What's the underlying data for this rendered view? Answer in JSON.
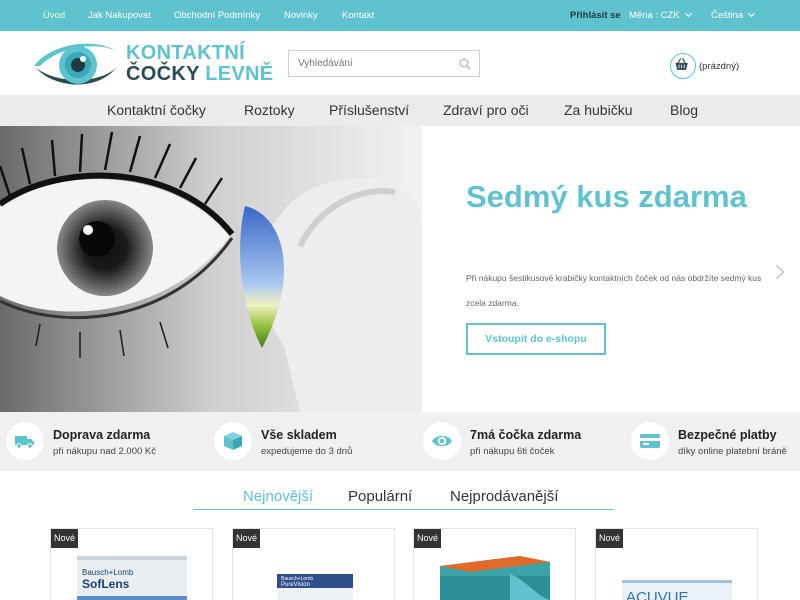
{
  "topbar": {
    "links": [
      "Úvod",
      "Jak Nakupovat",
      "Obchodní Podmínky",
      "Novinky",
      "Kontakt"
    ],
    "login": "Přihlásit se",
    "currency": "Měna : CZK",
    "language": "Čeština"
  },
  "header": {
    "logo_line1": "KONTAKTNÍ",
    "logo_line2a": "ČOČKY",
    "logo_line2b": "LEVNĚ",
    "search_placeholder": "Vyhledávání",
    "cart_label": "(prázdný)"
  },
  "nav": {
    "items": [
      "Kontaktní čočky",
      "Roztoky",
      "Příslušenství",
      "Zdraví pro oči",
      "Za hubičku",
      "Blog"
    ]
  },
  "hero": {
    "title": "Sedmý kus zdarma",
    "text": "Při nákupu šestikusové krabičky kontaktních čoček od nás obdržíte sedmý kus zcela zdarma.",
    "button": "Vstoupit do e-shopu"
  },
  "features": [
    {
      "title": "Doprava zdarma",
      "subtitle": "při nákupu nad 2.000 Kč",
      "icon": "truck-icon"
    },
    {
      "title": "Vše skladem",
      "subtitle": "expedujeme do 3 dnů",
      "icon": "box-icon"
    },
    {
      "title": "7má čočka zdarma",
      "subtitle": "při nákupu 6ti čoček",
      "icon": "eye-icon"
    },
    {
      "title": "Bezpečné platby",
      "subtitle": "díky online platební bráně",
      "icon": "card-icon"
    }
  ],
  "tabs": [
    "Nejnovější",
    "Populární",
    "Nejprodávanější"
  ],
  "products": [
    {
      "badge": "Nové",
      "brand": "Bausch+Lomb",
      "name": "SofLens"
    },
    {
      "badge": "Nové",
      "brand": "Bausch+Lomb",
      "name": "PureVision"
    },
    {
      "badge": "Nové",
      "brand": "",
      "name": ""
    },
    {
      "badge": "Nové",
      "brand": "",
      "name": "ACUVUE"
    }
  ],
  "colors": {
    "accent": "#5ec3cf",
    "dark": "#2b4a55",
    "nav_bg": "#ebebeb",
    "feature_bg": "#f0f0f0"
  }
}
